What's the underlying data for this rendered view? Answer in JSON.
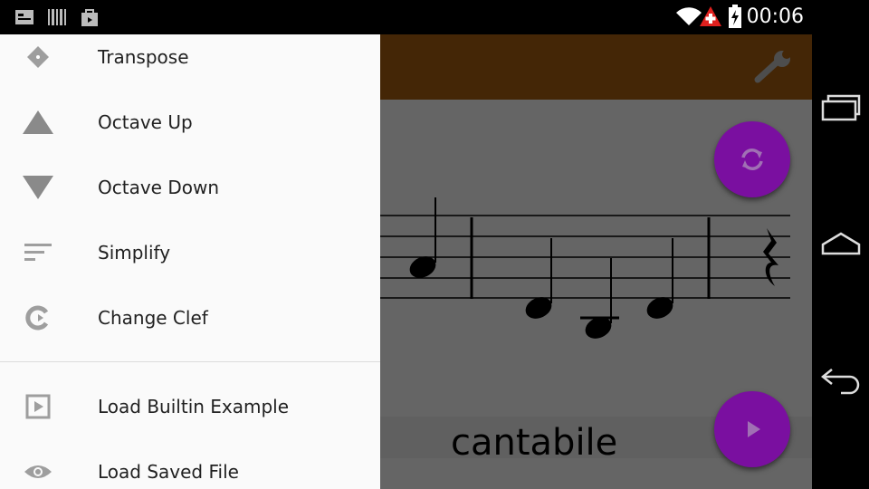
{
  "status_bar": {
    "time": "00:06",
    "left_icons": [
      "screen-icon",
      "barcode-icon",
      "shopping-bag-icon"
    ],
    "right_icons": [
      "wifi-icon",
      "alert-icon",
      "battery-icon"
    ]
  },
  "toolbar": {
    "color": "#ab5f0f",
    "action_icon": "wrench-icon"
  },
  "score": {
    "tempo_marking": "cantabile"
  },
  "fabs": {
    "refresh_icon": "refresh-icon",
    "play_icon": "play-icon",
    "color": "#7a0fa0"
  },
  "drawer": {
    "items": [
      {
        "label": "Transpose",
        "icon": "transpose-icon"
      },
      {
        "label": "Octave Up",
        "icon": "triangle-up-icon"
      },
      {
        "label": "Octave Down",
        "icon": "triangle-down-icon"
      },
      {
        "label": "Simplify",
        "icon": "simplify-icon"
      },
      {
        "label": "Change Clef",
        "icon": "change-clef-icon"
      }
    ],
    "items_secondary": [
      {
        "label": "Load Builtin Example",
        "icon": "play-box-icon"
      },
      {
        "label": "Load Saved File",
        "icon": "eye-icon"
      }
    ]
  },
  "nav_bar": {
    "buttons": [
      "recents-icon",
      "home-icon",
      "back-icon"
    ]
  }
}
